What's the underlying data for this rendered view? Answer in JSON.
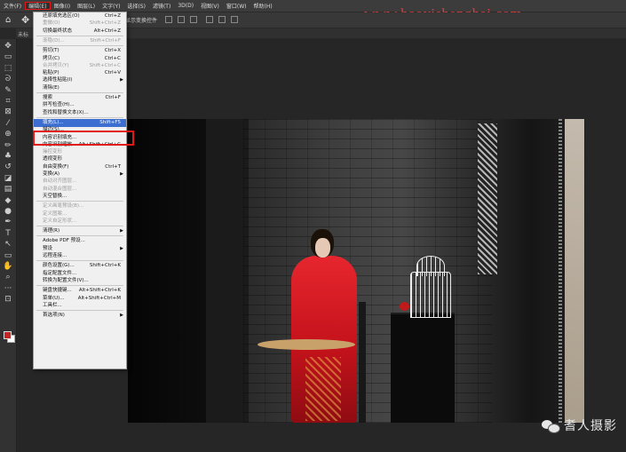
{
  "menubar": {
    "items": [
      {
        "label": "文件(F)"
      },
      {
        "label": "编辑(E)",
        "active": true
      },
      {
        "label": "图像(I)"
      },
      {
        "label": "图层(L)"
      },
      {
        "label": "文字(Y)"
      },
      {
        "label": "选择(S)"
      },
      {
        "label": "滤镜(T)"
      },
      {
        "label": "3D(D)"
      },
      {
        "label": "视图(V)"
      },
      {
        "label": "窗口(W)"
      },
      {
        "label": "帮助(H)"
      }
    ]
  },
  "watermark_url": "www.haoyishenghai.com",
  "options_bar": {
    "text": "显示变换控件"
  },
  "document_tab": {
    "label": "未标"
  },
  "edit_menu": {
    "items": [
      {
        "type": "item",
        "label": "还原填充选区(O)",
        "shortcut": "Ctrl+Z"
      },
      {
        "type": "item",
        "label": "重做(O)",
        "shortcut": "Shift+Ctrl+Z",
        "disabled": true
      },
      {
        "type": "item",
        "label": "切换最终状态",
        "shortcut": "Alt+Ctrl+Z"
      },
      {
        "type": "sep"
      },
      {
        "type": "item",
        "label": "渐隐(D)...",
        "shortcut": "Shift+Ctrl+F",
        "disabled": true
      },
      {
        "type": "sep"
      },
      {
        "type": "item",
        "label": "剪切(T)",
        "shortcut": "Ctrl+X"
      },
      {
        "type": "item",
        "label": "拷贝(C)",
        "shortcut": "Ctrl+C"
      },
      {
        "type": "item",
        "label": "合并拷贝(Y)",
        "shortcut": "Shift+Ctrl+C",
        "disabled": true
      },
      {
        "type": "item",
        "label": "粘贴(P)",
        "shortcut": "Ctrl+V"
      },
      {
        "type": "item",
        "label": "选择性粘贴(I)",
        "submenu": true
      },
      {
        "type": "item",
        "label": "清除(E)"
      },
      {
        "type": "sep"
      },
      {
        "type": "item",
        "label": "搜索",
        "shortcut": "Ctrl+F"
      },
      {
        "type": "item",
        "label": "拼写检查(H)..."
      },
      {
        "type": "item",
        "label": "查找和替换文本(X)..."
      },
      {
        "type": "sep"
      },
      {
        "type": "item",
        "label": "填充(L)...",
        "shortcut": "Shift+F5",
        "highlighted": true
      },
      {
        "type": "item",
        "label": "描边(S)..."
      },
      {
        "type": "item",
        "label": "内容识别填充..."
      },
      {
        "type": "item",
        "label": "内容识别缩放",
        "shortcut": "Alt+Shift+Ctrl+C"
      },
      {
        "type": "item",
        "label": "操控变形",
        "disabled": true
      },
      {
        "type": "item",
        "label": "透视变形"
      },
      {
        "type": "item",
        "label": "自由变换(F)",
        "shortcut": "Ctrl+T"
      },
      {
        "type": "item",
        "label": "变换(A)",
        "submenu": true
      },
      {
        "type": "item",
        "label": "自动对齐图层...",
        "disabled": true
      },
      {
        "type": "item",
        "label": "自动混合图层...",
        "disabled": true
      },
      {
        "type": "item",
        "label": "天空替换..."
      },
      {
        "type": "sep"
      },
      {
        "type": "item",
        "label": "定义画笔预设(B)...",
        "disabled": true
      },
      {
        "type": "item",
        "label": "定义图案...",
        "disabled": true
      },
      {
        "type": "item",
        "label": "定义自定形状...",
        "disabled": true
      },
      {
        "type": "sep"
      },
      {
        "type": "item",
        "label": "清理(R)",
        "submenu": true
      },
      {
        "type": "sep"
      },
      {
        "type": "item",
        "label": "Adobe PDF 预设..."
      },
      {
        "type": "item",
        "label": "预设",
        "submenu": true
      },
      {
        "type": "item",
        "label": "远程连接..."
      },
      {
        "type": "sep"
      },
      {
        "type": "item",
        "label": "颜色设置(G)...",
        "shortcut": "Shift+Ctrl+K"
      },
      {
        "type": "item",
        "label": "指定配置文件..."
      },
      {
        "type": "item",
        "label": "转换为配置文件(V)..."
      },
      {
        "type": "sep"
      },
      {
        "type": "item",
        "label": "键盘快捷键...",
        "shortcut": "Alt+Shift+Ctrl+K"
      },
      {
        "type": "item",
        "label": "菜单(U)...",
        "shortcut": "Alt+Shift+Ctrl+M"
      },
      {
        "type": "item",
        "label": "工具栏..."
      },
      {
        "type": "sep"
      },
      {
        "type": "item",
        "label": "首选项(N)",
        "submenu": true
      }
    ]
  },
  "tools": [
    {
      "name": "move-tool",
      "glyph": "✥"
    },
    {
      "name": "artboard-tool",
      "glyph": "▭"
    },
    {
      "name": "marquee-tool",
      "glyph": "⬚"
    },
    {
      "name": "lasso-tool",
      "glyph": "ᘐ"
    },
    {
      "name": "quick-select-tool",
      "glyph": "✎"
    },
    {
      "name": "crop-tool",
      "glyph": "⌗"
    },
    {
      "name": "frame-tool",
      "glyph": "⊠"
    },
    {
      "name": "eyedropper-tool",
      "glyph": "⁄"
    },
    {
      "name": "healing-tool",
      "glyph": "⊕"
    },
    {
      "name": "brush-tool",
      "glyph": "✏"
    },
    {
      "name": "clone-stamp-tool",
      "glyph": "♣"
    },
    {
      "name": "history-brush-tool",
      "glyph": "↺"
    },
    {
      "name": "eraser-tool",
      "glyph": "◪"
    },
    {
      "name": "gradient-tool",
      "glyph": "▤"
    },
    {
      "name": "blur-tool",
      "glyph": "◆"
    },
    {
      "name": "dodge-tool",
      "glyph": "●"
    },
    {
      "name": "pen-tool",
      "glyph": "✒"
    },
    {
      "name": "type-tool",
      "glyph": "T"
    },
    {
      "name": "path-select-tool",
      "glyph": "↖"
    },
    {
      "name": "rectangle-tool",
      "glyph": "▭"
    },
    {
      "name": "hand-tool",
      "glyph": "✋"
    },
    {
      "name": "zoom-tool",
      "glyph": "⌕"
    },
    {
      "name": "more-tools",
      "glyph": "···"
    },
    {
      "name": "edit-toolbar",
      "glyph": "⊡"
    }
  ],
  "colors": {
    "foreground": "#c42424",
    "background": "#ffffff",
    "highlight": "#3b6ed0",
    "annotation_red": "#e01818"
  },
  "watermark": {
    "text": "耆人摄影"
  }
}
